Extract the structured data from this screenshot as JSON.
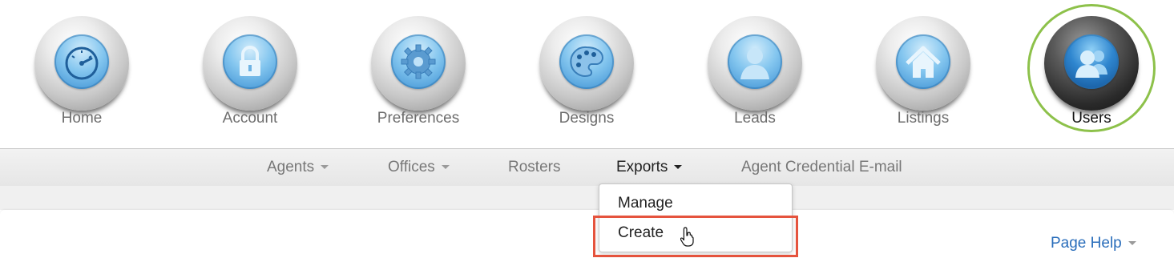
{
  "top_nav": {
    "items": [
      {
        "label": "Home",
        "icon": "dashboard-gauge-icon"
      },
      {
        "label": "Account",
        "icon": "lock-icon"
      },
      {
        "label": "Preferences",
        "icon": "gear-icon"
      },
      {
        "label": "Designs",
        "icon": "palette-icon"
      },
      {
        "label": "Leads",
        "icon": "person-icon"
      },
      {
        "label": "Listings",
        "icon": "house-icon"
      },
      {
        "label": "Users",
        "icon": "users-icon",
        "active": true
      }
    ],
    "active_ring_color": "#8dc14a"
  },
  "sub_nav": {
    "items": [
      {
        "label": "Agents",
        "has_caret": true
      },
      {
        "label": "Offices",
        "has_caret": true
      },
      {
        "label": "Rosters",
        "has_caret": false
      },
      {
        "label": "Exports",
        "has_caret": true,
        "open": true
      },
      {
        "label": "Agent Credential E-mail",
        "has_caret": false
      }
    ]
  },
  "exports_menu": {
    "items": [
      {
        "label": "Manage"
      },
      {
        "label": "Create",
        "highlighted": true
      }
    ],
    "highlight_color": "#e5533d"
  },
  "page_help": {
    "label": "Page Help"
  },
  "colors": {
    "link": "#2a6ebb",
    "orb_blue": "#3b8fd2"
  }
}
